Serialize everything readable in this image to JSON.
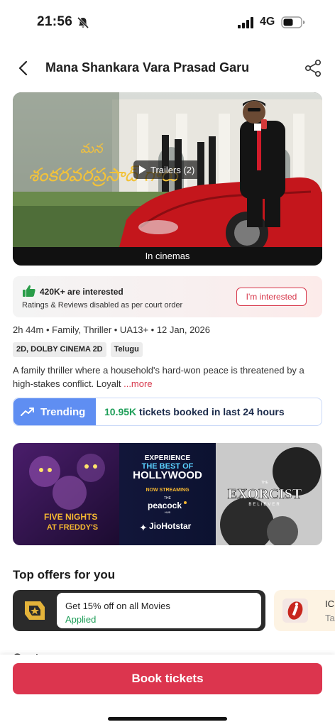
{
  "status_bar": {
    "time": "21:56",
    "network": "4G"
  },
  "header": {
    "title": "Mana Shankara Vara Prasad Garu"
  },
  "poster": {
    "trailer_label": "Trailers (2)",
    "caption": "In cinemas"
  },
  "interest": {
    "count_text": "420K+ are interested",
    "note": "Ratings & Reviews disabled as per court order",
    "button_label": "I'm interested"
  },
  "meta": {
    "line": "2h 44m  •  Family, Thriller  •  UA13+  •  12 Jan, 2026",
    "tags": [
      "2D, DOLBY CINEMA 2D",
      "Telugu"
    ],
    "synopsis": "A family thriller where a household's hard-won peace is threatened by a high-stakes conflict. Loyalt",
    "more_label": "...more"
  },
  "trending": {
    "badge_label": "Trending",
    "count": "10.95K",
    "text": "tickets booked in last 24 hours"
  },
  "banner": {
    "left_title_1": "FIVE NIGHTS",
    "left_title_2": "AT FREDDY'S",
    "center_line_1": "EXPERIENCE",
    "center_line_2": "THE BEST OF",
    "center_line_3": "HOLLYWOOD",
    "center_line_4": "NOW STREAMING",
    "peacock_small": "THE",
    "peacock": "peacock",
    "peacock_hub": "HUB",
    "jiohotstar": "JioHotstar",
    "right_small": "THE",
    "right_title": "EXORCIST",
    "right_sub": "BELIEVER"
  },
  "offers": {
    "section_title": "Top offers for you",
    "items": [
      {
        "title": "Get 15% off on all Movies",
        "status": "Applied"
      },
      {
        "title": "IC",
        "sub": "Ta"
      }
    ]
  },
  "next_section_peek": "Cast",
  "bottom": {
    "book_label": "Book tickets"
  },
  "colors": {
    "accent": "#dc354e",
    "trend_blue": "#5f8ef2",
    "success_green": "#1e9e58"
  }
}
